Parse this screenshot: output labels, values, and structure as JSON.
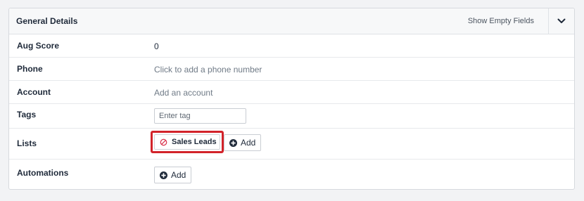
{
  "panel": {
    "title": "General Details",
    "show_empty_label": "Show Empty Fields",
    "collapse_icon": "chevron-down-icon"
  },
  "fields": {
    "aug_score": {
      "label": "Aug Score",
      "value": "0"
    },
    "phone": {
      "label": "Phone",
      "placeholder": "Click to add a phone number"
    },
    "account": {
      "label": "Account",
      "placeholder": "Add an account"
    },
    "tags": {
      "label": "Tags",
      "input_value": "",
      "input_placeholder": "Enter tag"
    },
    "lists": {
      "label": "Lists",
      "items": [
        {
          "name": "Sales Leads",
          "remove_icon": "remove-circle-icon"
        }
      ],
      "add_label": "Add",
      "highlighted": true,
      "highlight_color": "#d2232a"
    },
    "automations": {
      "label": "Automations",
      "add_label": "Add"
    }
  },
  "colors": {
    "label_text": "#1f2a3a",
    "muted_text": "#6f7a86",
    "remove_icon": "#d9364f",
    "border": "#d6d9de"
  }
}
